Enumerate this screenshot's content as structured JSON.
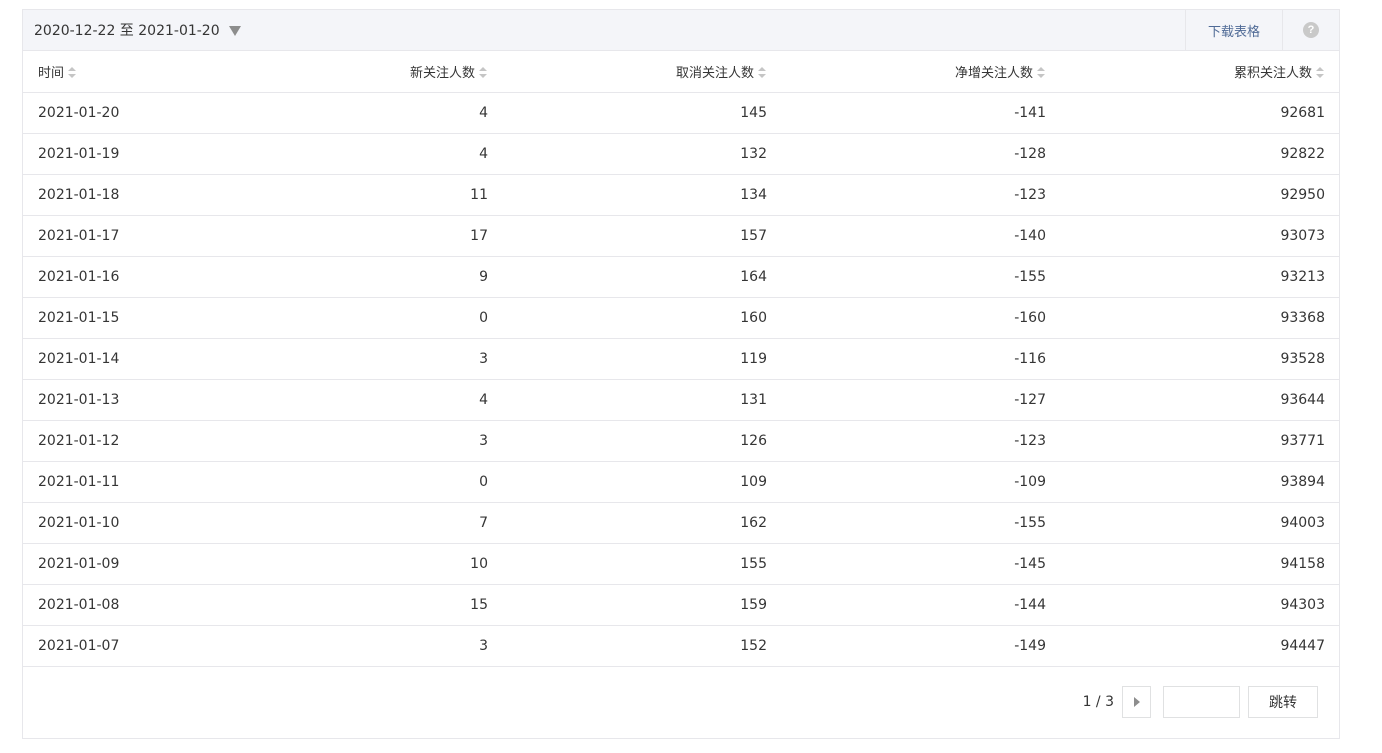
{
  "toolbar": {
    "date_range": "2020-12-22 至 2021-01-20",
    "download_label": "下载表格",
    "help_glyph": "?"
  },
  "table": {
    "columns": [
      "时间",
      "新关注人数",
      "取消关注人数",
      "净增关注人数",
      "累积关注人数"
    ],
    "rows": [
      [
        "2021-01-20",
        "4",
        "145",
        "-141",
        "92681"
      ],
      [
        "2021-01-19",
        "4",
        "132",
        "-128",
        "92822"
      ],
      [
        "2021-01-18",
        "11",
        "134",
        "-123",
        "92950"
      ],
      [
        "2021-01-17",
        "17",
        "157",
        "-140",
        "93073"
      ],
      [
        "2021-01-16",
        "9",
        "164",
        "-155",
        "93213"
      ],
      [
        "2021-01-15",
        "0",
        "160",
        "-160",
        "93368"
      ],
      [
        "2021-01-14",
        "3",
        "119",
        "-116",
        "93528"
      ],
      [
        "2021-01-13",
        "4",
        "131",
        "-127",
        "93644"
      ],
      [
        "2021-01-12",
        "3",
        "126",
        "-123",
        "93771"
      ],
      [
        "2021-01-11",
        "0",
        "109",
        "-109",
        "93894"
      ],
      [
        "2021-01-10",
        "7",
        "162",
        "-155",
        "94003"
      ],
      [
        "2021-01-09",
        "10",
        "155",
        "-145",
        "94158"
      ],
      [
        "2021-01-08",
        "15",
        "159",
        "-144",
        "94303"
      ],
      [
        "2021-01-07",
        "3",
        "152",
        "-149",
        "94447"
      ]
    ]
  },
  "pager": {
    "page_info": "1 / 3",
    "input_value": "",
    "jump_label": "跳转"
  },
  "icons": {
    "dropdown": "caret-down-icon",
    "sort": "sort-icon",
    "help": "help-icon",
    "next": "next-page-icon"
  }
}
